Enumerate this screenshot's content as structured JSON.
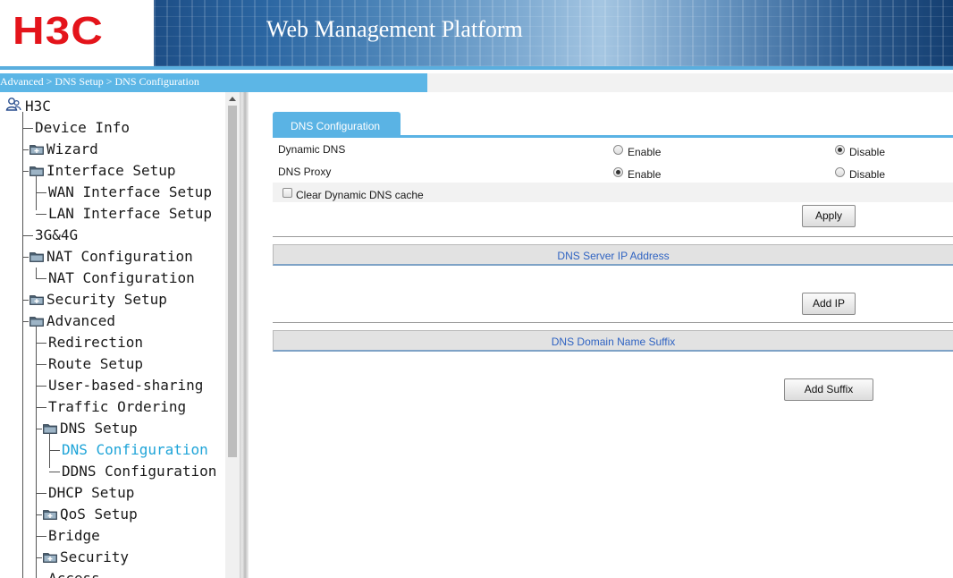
{
  "header": {
    "logo_text": "H3C",
    "title": "Web Management Platform"
  },
  "breadcrumb": "Advanced > DNS Setup > DNS Configuration",
  "sidebar": {
    "root": "H3C",
    "items": [
      {
        "label": "Device Info",
        "icon": "none"
      },
      {
        "label": "Wizard",
        "icon": "folder-plus-icon"
      },
      {
        "label": "Interface Setup",
        "icon": "folder-open-icon"
      },
      {
        "label": "WAN Interface Setup",
        "icon": "none"
      },
      {
        "label": "LAN Interface Setup",
        "icon": "none"
      },
      {
        "label": "3G&4G",
        "icon": "none"
      },
      {
        "label": "NAT Configuration",
        "icon": "folder-open-icon"
      },
      {
        "label": "NAT Configuration",
        "icon": "none"
      },
      {
        "label": "Security Setup",
        "icon": "folder-plus-icon"
      },
      {
        "label": "Advanced",
        "icon": "folder-open-icon"
      },
      {
        "label": "Redirection",
        "icon": "none"
      },
      {
        "label": "Route Setup",
        "icon": "none"
      },
      {
        "label": "User-based-sharing",
        "icon": "none"
      },
      {
        "label": "Traffic Ordering",
        "icon": "none"
      },
      {
        "label": "DNS Setup",
        "icon": "folder-open-icon"
      },
      {
        "label": "DNS Configuration",
        "icon": "none",
        "active": true
      },
      {
        "label": "DDNS Configuration",
        "icon": "none"
      },
      {
        "label": "DHCP Setup",
        "icon": "none"
      },
      {
        "label": "QoS Setup",
        "icon": "folder-plus-icon"
      },
      {
        "label": "Bridge",
        "icon": "none"
      },
      {
        "label": "Security",
        "icon": "folder-plus-icon"
      },
      {
        "label": "Access",
        "icon": "none"
      }
    ]
  },
  "content": {
    "tab_label": "DNS Configuration",
    "dynamic_dns": {
      "label": "Dynamic DNS",
      "enable": "Enable",
      "disable": "Disable",
      "selected": "disable"
    },
    "dns_proxy": {
      "label": "DNS Proxy",
      "enable": "Enable",
      "disable": "Disable",
      "selected": "enable"
    },
    "clear_cache_label": "Clear Dynamic DNS cache",
    "apply_label": "Apply",
    "dns_server_header": "DNS Server IP Address",
    "add_ip_label": "Add IP",
    "dns_suffix_header": "DNS Domain Name Suffix",
    "add_suffix_label": "Add Suffix"
  },
  "colors": {
    "brand_red": "#e4141b",
    "accent_blue": "#5ab3e4",
    "active_link": "#1ea4d8",
    "section_text": "#2f63c2"
  }
}
